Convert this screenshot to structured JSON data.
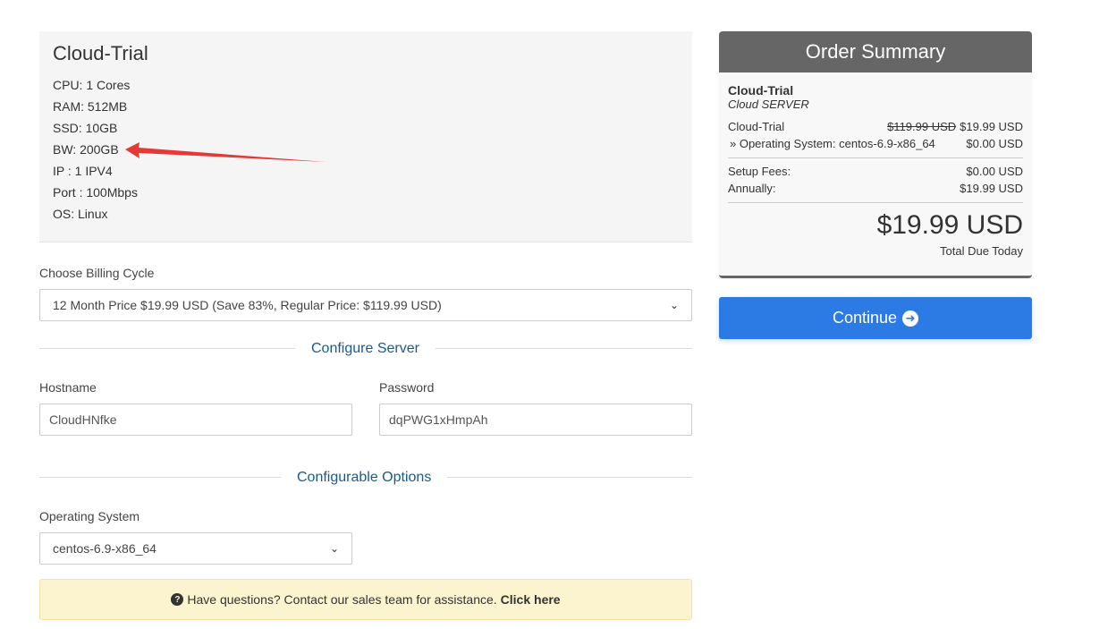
{
  "product": {
    "title": "Cloud-Trial",
    "specs": [
      "CPU: 1 Cores",
      "RAM: 512MB",
      "SSD: 10GB",
      "BW: 200GB",
      "IP : 1 IPV4",
      "Port : 100Mbps",
      "OS: Linux"
    ]
  },
  "billing": {
    "label": "Choose Billing Cycle",
    "selected": "12 Month Price $19.99 USD (Save 83%, Regular Price: $119.99 USD)"
  },
  "configure_server": {
    "heading": "Configure Server",
    "hostname_label": "Hostname",
    "hostname_value": "CloudHNfke",
    "password_label": "Password",
    "password_value": "dqPWG1xHmpAh"
  },
  "configurable_options": {
    "heading": "Configurable Options",
    "os_label": "Operating System",
    "os_selected": "centos-6.9-x86_64"
  },
  "alert": {
    "text": "Have questions? Contact our sales team for assistance.",
    "link": "Click here"
  },
  "summary": {
    "title": "Order Summary",
    "product_name": "Cloud-Trial",
    "product_group": "Cloud SERVER",
    "line_item": "Cloud-Trial",
    "line_old_price": "$119.99 USD",
    "line_price": "$19.99 USD",
    "os_item": "» Operating System: centos-6.9-x86_64",
    "os_price": "$0.00 USD",
    "setup_label": "Setup Fees:",
    "setup_value": "$0.00 USD",
    "annual_label": "Annually:",
    "annual_value": "$19.99 USD",
    "total": "$19.99 USD",
    "total_label": "Total Due Today"
  },
  "continue_label": "Continue",
  "colors": {
    "accent": "#2c7ae4",
    "summary_header": "#666666",
    "alert_bg": "#fcf3cf",
    "arrow": "#e53935"
  }
}
